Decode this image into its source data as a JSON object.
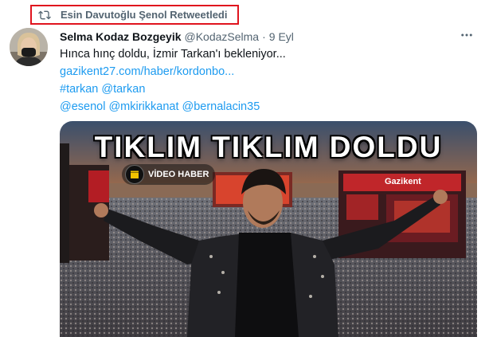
{
  "retweet": {
    "icon": "retweet-icon",
    "text": "Esin Davutoğlu Şenol Retweetledi",
    "highlight_color": "#e0141e"
  },
  "tweet": {
    "author_name": "Selma Kodaz Bozgeyik",
    "handle": "@KodazSelma",
    "separator": "·",
    "date": "9 Eyl",
    "text": "Hınca hınç doldu, İzmir Tarkan'ı bekleniyor...",
    "link": "gazikent27.com/haber/kordonbo...",
    "hashtags": [
      "#tarkan",
      "@tarkan"
    ],
    "mentions": [
      "@esenol",
      "@mkirikkanat",
      "@bernalacin35"
    ]
  },
  "media": {
    "headline": "TIKLIM TIKLIM DOLDU",
    "badge": "VİDEO HABER",
    "banner": "Gazikent"
  },
  "colors": {
    "link": "#1d9bf0",
    "secondary_text": "#536471",
    "primary_text": "#0f1419"
  }
}
